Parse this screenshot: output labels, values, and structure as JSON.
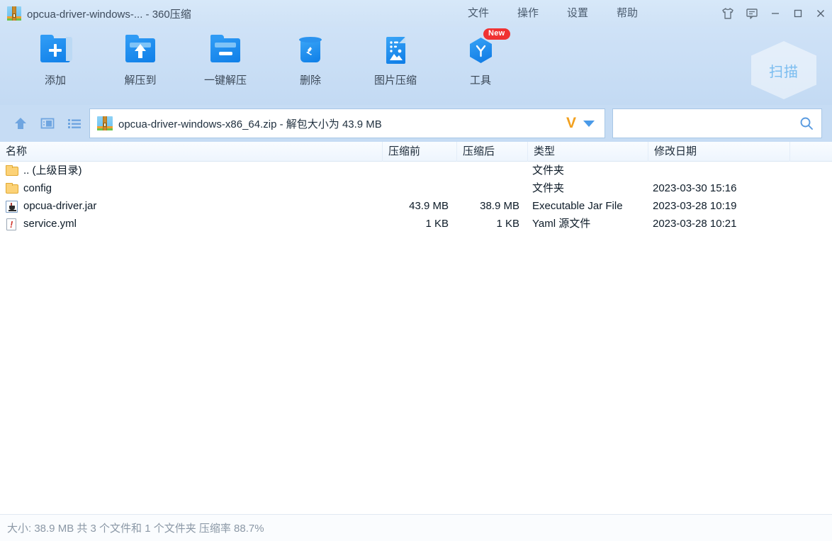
{
  "titlebar": {
    "icon": "zip-archive-icon",
    "title": "opcua-driver-windows-... - 360压缩",
    "menus": [
      {
        "label": "文件",
        "name": "menu-file"
      },
      {
        "label": "操作",
        "name": "menu-operation"
      },
      {
        "label": "设置",
        "name": "menu-settings"
      },
      {
        "label": "帮助",
        "name": "menu-help"
      }
    ],
    "skin_icon": "tshirt-skin-icon",
    "feedback_icon": "feedback-bubble-icon",
    "minimize": "−",
    "maximize": "□",
    "close": "✕"
  },
  "toolbar": {
    "items": [
      {
        "label": "添加",
        "icon": "folder-add-icon",
        "badge": ""
      },
      {
        "label": "解压到",
        "icon": "folder-extract-to-icon",
        "badge": ""
      },
      {
        "label": "一键解压",
        "icon": "folder-one-click-extract-icon",
        "badge": ""
      },
      {
        "label": "删除",
        "icon": "trash-delete-icon",
        "badge": ""
      },
      {
        "label": "图片压缩",
        "icon": "image-compress-icon",
        "badge": ""
      },
      {
        "label": "工具",
        "icon": "tools-hexagon-icon",
        "badge": "New"
      }
    ],
    "scan_label": "扫描"
  },
  "navbar": {
    "up_icon": "navigate-up-icon",
    "preview_icon": "preview-pane-icon",
    "list_icon": "list-view-icon",
    "address_icon": "zip-archive-icon",
    "address_text": "opcua-driver-windows-x86_64.zip - 解包大小为 43.9 MB",
    "vlogo": "V",
    "dropdown_icon": "chevron-down-icon",
    "search_value": "",
    "search_placeholder": "",
    "search_icon": "search-icon"
  },
  "filelist": {
    "columns": [
      {
        "label": "名称",
        "name": "column-name"
      },
      {
        "label": "压缩前",
        "name": "column-size-before"
      },
      {
        "label": "压缩后",
        "name": "column-size-after"
      },
      {
        "label": "类型",
        "name": "column-type"
      },
      {
        "label": "修改日期",
        "name": "column-modified"
      }
    ],
    "rows": [
      {
        "icon": "folder-icon",
        "name": ".. (上级目录)",
        "before": "",
        "after": "",
        "type": "文件夹",
        "date": ""
      },
      {
        "icon": "folder-icon",
        "name": "config",
        "before": "",
        "after": "",
        "type": "文件夹",
        "date": "2023-03-30 15:16"
      },
      {
        "icon": "jar-file-icon",
        "name": "opcua-driver.jar",
        "before": "43.9 MB",
        "after": "38.9 MB",
        "type": "Executable Jar File",
        "date": "2023-03-28 10:19"
      },
      {
        "icon": "yml-file-icon",
        "name": "service.yml",
        "before": "1 KB",
        "after": "1 KB",
        "type": "Yaml 源文件",
        "date": "2023-03-28 10:21"
      }
    ]
  },
  "statusbar": {
    "text": "大小: 38.9 MB 共 3 个文件和 1 个文件夹 压缩率 88.7%"
  },
  "colors": {
    "titlebar": "#d3e5f8",
    "toolbar": "#c9dff5",
    "navbar": "#c6dcf4",
    "accent_blue": "#1e88e5",
    "badge_red": "#f03232",
    "vlogo_orange": "#f2a01e",
    "folder_yellow": "#fcd277",
    "status_text": "#8b98a6"
  }
}
